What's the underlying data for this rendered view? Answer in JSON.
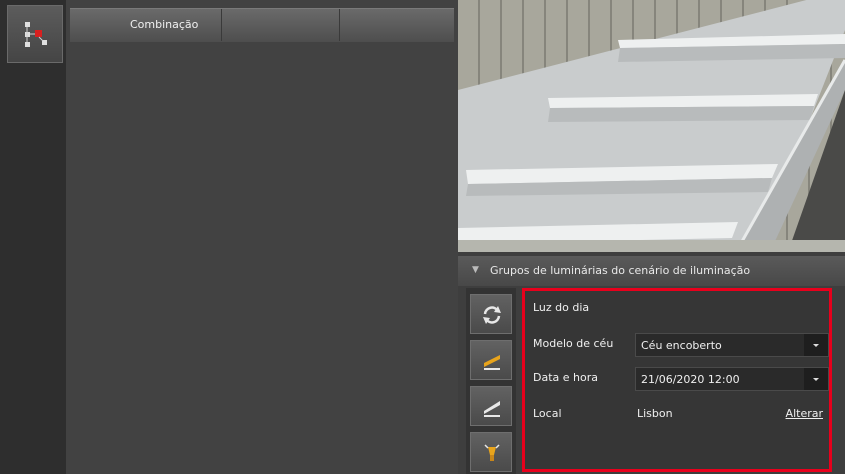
{
  "table": {
    "columns": [
      "Combinação",
      "",
      ""
    ]
  },
  "scenario_panel": {
    "title": "Grupos de luminárias do cenário de iluminação",
    "daylight": {
      "heading": "Luz do dia",
      "sky_model_label": "Modelo de céu",
      "sky_model_value": "Céu encoberto",
      "datetime_label": "Data e hora",
      "datetime_value": "21/06/2020 12:00",
      "location_label": "Local",
      "location_value": "Lisbon",
      "change_link": "Alterar"
    }
  },
  "icons": {
    "tool": "lighting-node-icon",
    "side": [
      "refresh-icon",
      "light-group-icon",
      "light-add-icon",
      "luminaire-icon"
    ]
  },
  "colors": {
    "highlight": "#e8001c",
    "icon_accent": "#e8a41c"
  }
}
